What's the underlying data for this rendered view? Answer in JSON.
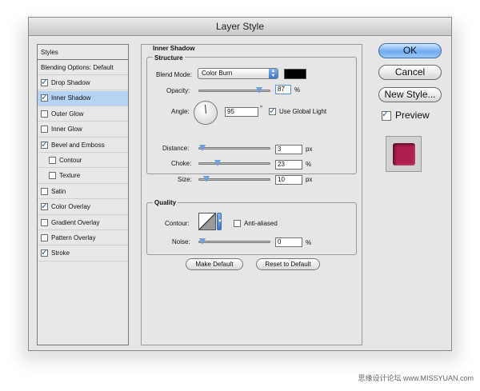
{
  "window": {
    "title": "Layer Style"
  },
  "styles_list": {
    "header": "Styles",
    "items": [
      {
        "label": "Blending Options: Default",
        "checkbox": false,
        "checked": false,
        "indent": false,
        "selected": false
      },
      {
        "label": "Drop Shadow",
        "checkbox": true,
        "checked": true,
        "indent": false,
        "selected": false
      },
      {
        "label": "Inner Shadow",
        "checkbox": true,
        "checked": true,
        "indent": false,
        "selected": true
      },
      {
        "label": "Outer Glow",
        "checkbox": true,
        "checked": false,
        "indent": false,
        "selected": false
      },
      {
        "label": "Inner Glow",
        "checkbox": true,
        "checked": false,
        "indent": false,
        "selected": false
      },
      {
        "label": "Bevel and Emboss",
        "checkbox": true,
        "checked": true,
        "indent": false,
        "selected": false
      },
      {
        "label": "Contour",
        "checkbox": true,
        "checked": false,
        "indent": true,
        "selected": false
      },
      {
        "label": "Texture",
        "checkbox": true,
        "checked": false,
        "indent": true,
        "selected": false
      },
      {
        "label": "Satin",
        "checkbox": true,
        "checked": false,
        "indent": false,
        "selected": false
      },
      {
        "label": "Color Overlay",
        "checkbox": true,
        "checked": true,
        "indent": false,
        "selected": false
      },
      {
        "label": "Gradient Overlay",
        "checkbox": true,
        "checked": false,
        "indent": false,
        "selected": false
      },
      {
        "label": "Pattern Overlay",
        "checkbox": true,
        "checked": false,
        "indent": false,
        "selected": false
      },
      {
        "label": "Stroke",
        "checkbox": true,
        "checked": true,
        "indent": false,
        "selected": false
      }
    ]
  },
  "inner_shadow": {
    "title": "Inner Shadow",
    "structure": {
      "title": "Structure",
      "blend_mode_label": "Blend Mode:",
      "blend_mode_value": "Color Burn",
      "shadow_color": "#000000",
      "opacity_label": "Opacity:",
      "opacity_value": "87",
      "opacity_unit": "%",
      "opacity_fraction": 0.87,
      "angle_label": "Angle:",
      "angle_value": "95",
      "angle_unit": "°",
      "use_global_light_label": "Use Global Light",
      "use_global_light_checked": true,
      "distance_label": "Distance:",
      "distance_value": "3",
      "distance_unit": "px",
      "distance_fraction": 0.0,
      "choke_label": "Choke:",
      "choke_value": "23",
      "choke_unit": "%",
      "choke_fraction": 0.23,
      "size_label": "Size:",
      "size_value": "10",
      "size_unit": "px",
      "size_fraction": 0.06
    },
    "quality": {
      "title": "Quality",
      "contour_label": "Contour:",
      "anti_aliased_label": "Anti-aliased",
      "anti_aliased_checked": false,
      "noise_label": "Noise:",
      "noise_value": "0",
      "noise_unit": "%",
      "noise_fraction": 0.0
    },
    "make_default_label": "Make Default",
    "reset_default_label": "Reset to Default"
  },
  "buttons": {
    "ok": "OK",
    "cancel": "Cancel",
    "new_style": "New Style...",
    "preview_label": "Preview",
    "preview_checked": true
  },
  "preview_color": "#b0204e",
  "watermark": "思缘设计论坛 www.MISSYUAN.com"
}
